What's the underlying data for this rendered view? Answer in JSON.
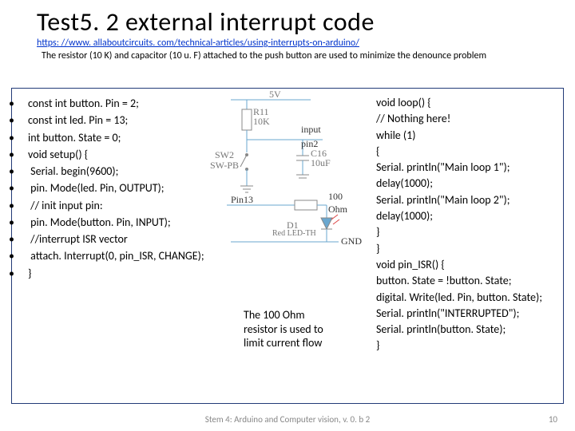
{
  "title": "Test5. 2 external interrupt code",
  "url": "https: //www. allaboutcircuits. com/technical-articles/using-interrupts-on-arduino/",
  "subhead": "The resistor (10 K) and capacitor (10 u. F) attached to the push button are used to minimize the denounce problem",
  "left_code": [
    "const int button. Pin = 2;",
    "const int led. Pin =  13;",
    "int button. State = 0;",
    "void setup() {",
    " Serial. begin(9600);",
    " pin. Mode(led. Pin, OUTPUT);",
    " // init input pin:",
    " pin. Mode(button. Pin, INPUT);",
    " //interrupt ISR vector",
    " attach. Interrupt(0, pin_ISR, CHANGE);",
    "}"
  ],
  "right_code": [
    "void loop() {",
    "  // Nothing here!",
    "  while (1)",
    "  {",
    "     Serial. println(\"Main loop 1\");",
    "     delay(1000);",
    "     Serial. println(\"Main loop 2\");",
    "     delay(1000);",
    "   }",
    "}",
    "void pin_ISR() {",
    "   button. State = !button. State;",
    "   digital. Write(led. Pin, button. State);",
    "   Serial. println(\"INTERRUPTED\");",
    "   Serial. println(button. State);",
    "}"
  ],
  "diagram": {
    "top": "5V",
    "r11": "R11",
    "r11v": "10K",
    "sw": "SW2",
    "swn": "SW-PB",
    "input_lbl": "input",
    "pin2": "pin2",
    "c16": "C16",
    "c16v": "10uF",
    "pin13": "Pin13",
    "r100a": "100",
    "r100b": "Ohm",
    "d1": "D1",
    "d1n": "Red LED-TH",
    "gnd": "GND"
  },
  "note": "The 100 Ohm resistor is used  to limit current flow",
  "footer": "Stem 4: Arduino and Computer vision, v. 0. b 2",
  "pagenum": "10"
}
